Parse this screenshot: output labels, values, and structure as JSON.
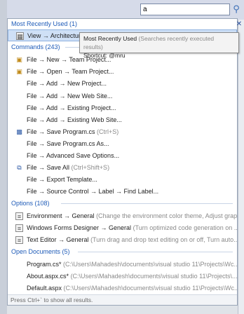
{
  "search": {
    "value": "a"
  },
  "sections": {
    "mru": {
      "header": "Most Recently Used (1)"
    },
    "commands": {
      "header": "Commands (243)"
    },
    "options": {
      "header": "Options (108)"
    },
    "documents": {
      "header": "Open Documents (5)"
    }
  },
  "mru_items": [
    {
      "label": "View → Architecture Explorer"
    }
  ],
  "command_items": [
    {
      "label": "File → New → Team Project...",
      "icon": "team-project-icon"
    },
    {
      "label": "File → Open → Team Project...",
      "icon": "team-project-icon"
    },
    {
      "label": "File → Add → New Project...",
      "icon": ""
    },
    {
      "label": "File → Add → New Web Site...",
      "icon": ""
    },
    {
      "label": "File → Add → Existing Project...",
      "icon": ""
    },
    {
      "label": "File → Add → Existing Web Site...",
      "icon": ""
    },
    {
      "label": "File → Save Program.cs",
      "shortcut": "(Ctrl+S)",
      "icon": "save-icon"
    },
    {
      "label": "File → Save Program.cs As...",
      "icon": ""
    },
    {
      "label": "File → Advanced Save Options...",
      "icon": ""
    },
    {
      "label": "File → Save All",
      "shortcut": "(Ctrl+Shift+S)",
      "icon": "save-all-icon"
    },
    {
      "label": "File → Export Template...",
      "icon": ""
    },
    {
      "label": "File → Source Control → Label → Find Label...",
      "icon": ""
    }
  ],
  "option_items": [
    {
      "label": "Environment → General",
      "desc": "(Change the environment color theme, Adjust grap..."
    },
    {
      "label": "Windows Forms Designer → General",
      "desc": "(Turn optimized code generation on ..."
    },
    {
      "label": "Text Editor → General",
      "desc": "(Turn drag and drop text editing on or off, Turn auto..."
    }
  ],
  "document_items": [
    {
      "label": "Program.cs*",
      "desc": "(C:\\Users\\Mahadesh\\documents\\visual studio 11\\Projects\\Wc..."
    },
    {
      "label": "About.aspx.cs*",
      "desc": "(C:\\Users\\Mahadesh\\documents\\visual studio 11\\Projects\\..."
    },
    {
      "label": "Default.aspx",
      "desc": "(C:\\Users\\Mahadesh\\documents\\visual studio 11\\Projects\\Wc..."
    }
  ],
  "tooltip": {
    "title": "Most Recently Used",
    "desc": "(Searches recently executed results)",
    "shortcut_line": "Shortcut: @mru"
  },
  "footer": {
    "text": "Press Ctrl+` to show all results."
  },
  "icons": {
    "search": "search-icon",
    "close": "close-icon"
  },
  "colors": {
    "section_header": "#1e5bb8",
    "selection": "#cfe0f6",
    "description": "#8a8a8a"
  }
}
